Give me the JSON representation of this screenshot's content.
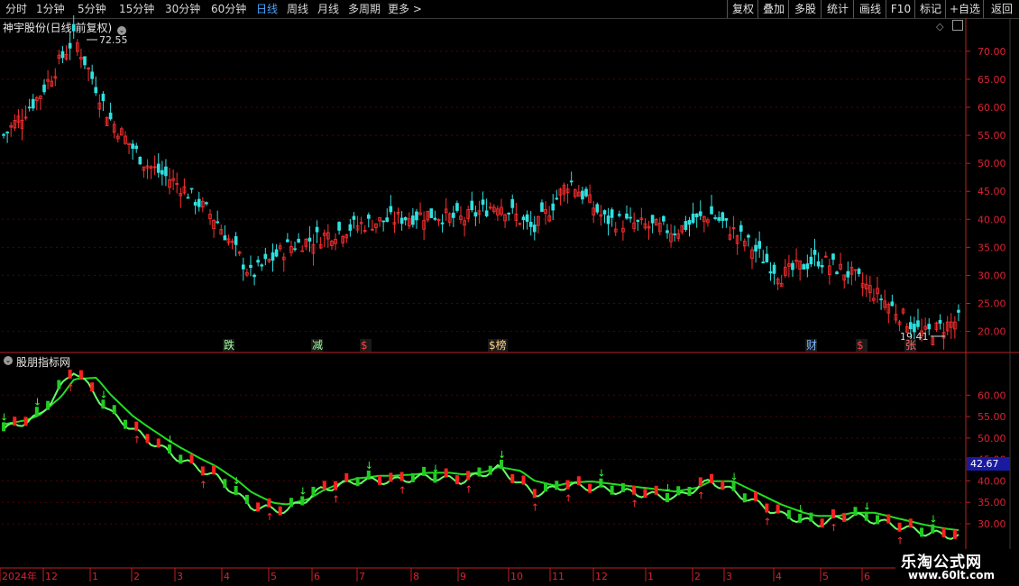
{
  "toolbar": {
    "periods": [
      "分时",
      "1分钟",
      "5分钟",
      "15分钟",
      "30分钟",
      "60分钟",
      "日线",
      "周线",
      "月线",
      "多周期",
      "更多 >"
    ],
    "active_period": "日线",
    "right_buttons": [
      "复权",
      "叠加",
      "多股",
      "统计",
      "画线",
      "F10",
      "标记",
      "+自选",
      "返回"
    ]
  },
  "main_chart": {
    "title": "神宇股份(日线 前复权)",
    "high_label": "72.55",
    "low_label": "19.41",
    "y_ticks": [
      "70.00",
      "65.00",
      "60.00",
      "55.00",
      "50.00",
      "45.00",
      "40.00",
      "35.00",
      "30.00",
      "25.00",
      "20.00"
    ],
    "markers": [
      {
        "text": "跌",
        "color": "#9dff9d"
      },
      {
        "text": "减",
        "color": "#9dff9d"
      },
      {
        "text": "$",
        "color": "#ff4040"
      },
      {
        "text": "$榜",
        "color": "#ffd28a"
      },
      {
        "text": "财",
        "color": "#7ab8ff"
      },
      {
        "text": "$",
        "color": "#ff4040"
      },
      {
        "text": "张",
        "color": "#ff6a6a"
      }
    ]
  },
  "indicator_chart": {
    "title": "股朋指标网",
    "y_ticks": [
      "60.00",
      "55.00",
      "50.00",
      "45.00",
      "40.00",
      "35.00",
      "30.00"
    ],
    "current_value": "42.67"
  },
  "x_axis": {
    "labels": [
      "2024年",
      "12",
      "1",
      "2",
      "3",
      "4",
      "5",
      "6",
      "7",
      "8",
      "9",
      "10",
      "11",
      "12",
      "1",
      "2",
      "3",
      "4",
      "5",
      "6"
    ]
  },
  "watermark": {
    "name": "乐淘公式网",
    "url": "www.60lt.com"
  },
  "colors": {
    "up": "#ff3030",
    "down": "#30e0e0",
    "indicator_line": "#33ff33",
    "axis": "#c02020",
    "active_tab": "#4aa3ff"
  },
  "chart_data": {
    "type": "candlestick",
    "x_labels": [
      "2024年",
      "12",
      "1",
      "2",
      "3",
      "4",
      "5",
      "6",
      "7",
      "8",
      "9",
      "10",
      "11",
      "12",
      "1",
      "2",
      "3",
      "4",
      "5",
      "6"
    ],
    "close_trend": [
      55,
      62,
      72.55,
      58,
      50,
      46,
      40,
      30,
      35,
      37,
      39,
      40,
      41,
      40,
      43,
      38,
      47,
      40,
      39,
      38,
      41,
      36,
      30,
      33,
      30,
      25,
      19.41,
      22
    ],
    "ylim": [
      18,
      74
    ],
    "indicator_ylim": [
      26,
      67
    ],
    "indicator_trend": [
      52,
      55,
      66,
      56,
      50,
      45,
      41,
      34,
      33,
      38,
      40,
      40,
      41,
      40,
      43,
      37,
      39,
      38,
      37,
      36,
      40,
      36,
      32,
      30,
      32,
      30,
      28,
      27
    ]
  }
}
